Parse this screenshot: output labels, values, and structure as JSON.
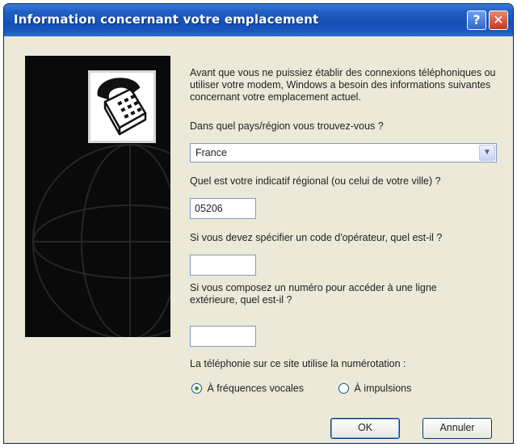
{
  "window": {
    "title": "Information concernant votre emplacement",
    "help_glyph": "?",
    "close_glyph": "✕"
  },
  "banner": {
    "icon": "telephone-icon",
    "background": "#0a0a0a"
  },
  "form": {
    "intro": "Avant que vous ne puissiez établir des connexions téléphoniques ou utiliser votre modem, Windows a besoin des informations suivantes concernant votre emplacement actuel.",
    "country_label": "Dans quel pays/région vous trouvez-vous ?",
    "country_value": "France",
    "area_code_label": "Quel est votre indicatif régional (ou celui de votre ville) ?",
    "area_code_value": "05206",
    "carrier_label": "Si vous devez spécifier un code d'opérateur, quel est-il ?",
    "carrier_value": "",
    "outside_line_label": "Si vous composez un numéro pour accéder à une ligne extérieure, quel est-il ?",
    "outside_line_value": "",
    "dialing_label": "La téléphonie sur ce site utilise la numérotation :",
    "dialing_options": [
      {
        "label": "À fréquences vocales",
        "selected": true
      },
      {
        "label": "À impulsions",
        "selected": false
      }
    ]
  },
  "buttons": {
    "ok": "OK",
    "cancel": "Annuler"
  },
  "colors": {
    "titlebar": "#1650b6",
    "dialog_bg": "#ece9d8",
    "close_button": "#c2391c"
  }
}
